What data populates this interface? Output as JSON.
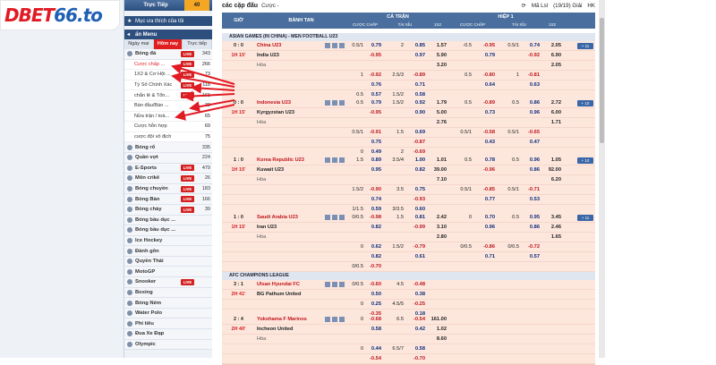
{
  "brand": {
    "logo_left": "D",
    "logo_mid": "BET",
    "logo_num": "66.to"
  },
  "sidebar": {
    "live_label": "Trực Tiếp",
    "live_count": "40",
    "fav_label": "Mục ưa thích của tôi",
    "menu_label": "ẩn Menu",
    "day_tabs": [
      "Ngày mai",
      "Hôm nay",
      "Trực tiếp"
    ],
    "sports": [
      {
        "name": "Bóng đá",
        "live": true,
        "count": "343"
      },
      {
        "name": "Bóng rổ",
        "live": false,
        "count": "335"
      },
      {
        "name": "Quần vợt",
        "live": false,
        "count": "224"
      },
      {
        "name": "E-Sports",
        "live": true,
        "count": "479"
      },
      {
        "name": "Môn crikê",
        "live": true,
        "count": "26"
      },
      {
        "name": "Bóng chuyền",
        "live": true,
        "count": "183"
      },
      {
        "name": "Bóng Bàn",
        "live": true,
        "count": "166"
      },
      {
        "name": "Bóng chày",
        "live": true,
        "count": "39"
      },
      {
        "name": "Bóng bầu dục ...",
        "live": false,
        "count": ""
      },
      {
        "name": "Bóng bầu dục ...",
        "live": false,
        "count": ""
      },
      {
        "name": "Ice Hockey",
        "live": false,
        "count": ""
      },
      {
        "name": "Đánh gôn",
        "live": false,
        "count": ""
      },
      {
        "name": "Quyền Thái",
        "live": false,
        "count": ""
      },
      {
        "name": "MotoGP",
        "live": false,
        "count": ""
      },
      {
        "name": "Snooker",
        "live": true,
        "count": ""
      },
      {
        "name": "Boxing",
        "live": false,
        "count": ""
      },
      {
        "name": "Bóng Ném",
        "live": false,
        "count": ""
      },
      {
        "name": "Water Polo",
        "live": false,
        "count": ""
      },
      {
        "name": "Phi tiêu",
        "live": false,
        "count": ""
      },
      {
        "name": "Đua Xe Đạp",
        "live": false,
        "count": ""
      },
      {
        "name": "Olympic",
        "live": false,
        "count": ""
      }
    ],
    "football_sub": [
      {
        "name": "Cược chấp ...",
        "live": true,
        "count": "266"
      },
      {
        "name": "1X2 & Cơ Hội ...",
        "live": true,
        "count": "73"
      },
      {
        "name": "Tỷ Số Chính Xác",
        "live": true,
        "count": "118"
      },
      {
        "name": "chẵn lẻ & Tổn...",
        "live": true,
        "count": "161"
      },
      {
        "name": "Bàn đầu/Bàn ...",
        "live": false,
        "count": "32"
      },
      {
        "name": "Nửa trận / toà...",
        "live": false,
        "count": "65"
      },
      {
        "name": "Cược hỗn hợp",
        "live": false,
        "count": "69"
      },
      {
        "name": "cược đội vô địch",
        "live": false,
        "count": "75"
      }
    ]
  },
  "topbar": {
    "title": "các cặp đấu",
    "market_select": "Cược -",
    "view_select": "Mã Lsl",
    "matches_count": "(19/19) Giải",
    "odds_type": "HK"
  },
  "table_header": {
    "time": "GIỜ",
    "teams": "BÀNH TAN",
    "full_time": "CẢ TRẬN",
    "first_half": "HIỆP 1",
    "hdp": "CƯỢC CHẤP",
    "ou": "TÀI XỈU",
    "x12": "1X2"
  },
  "leagues": [
    {
      "name": "ASIAN GAMES (IN CHINA) - MEN FOOTBALL U23"
    },
    {
      "name": "AFC CHAMPIONS LEAGUE"
    }
  ],
  "matches": [
    {
      "score": "0 : 0",
      "period": "1H 15'",
      "home": "China U23",
      "away": "India U23",
      "draw": "Hòa",
      "more": "+ 11",
      "rows": [
        [
          "0.5/1",
          "0.79",
          "2",
          "0.85",
          "1.57",
          "-0.5",
          "-0.95",
          "0.5/1",
          "0.74",
          "2.05"
        ],
        [
          "",
          "-0.95",
          "",
          "0.97",
          "5.90",
          "",
          "0.79",
          "",
          "-0.92",
          "6.90"
        ],
        [
          "",
          "",
          "",
          "",
          "3.20",
          "",
          "",
          "",
          "",
          "2.05"
        ]
      ],
      "extra": [
        [
          "1",
          "-0.92",
          "2.5/3",
          "-0.89",
          "",
          "0.5",
          "-0.80",
          "1",
          "-0.81",
          ""
        ],
        [
          "",
          "0.76",
          "",
          "0.71",
          "",
          "",
          "0.64",
          "",
          "0.63",
          ""
        ],
        [
          "0.5",
          "0.57",
          "1.5/2",
          "0.58",
          "",
          "",
          "",
          "",
          "",
          ""
        ],
        [
          "",
          "-0.73",
          "",
          "-0.76",
          "",
          "",
          "",
          "",
          "",
          ""
        ]
      ]
    },
    {
      "score": "0 : 0",
      "period": "1H 15'",
      "home": "Indonesia U23",
      "away": "Kyrgyzstan U23",
      "draw": "Hòa",
      "more": "+ 10",
      "rows": [
        [
          "0.5",
          "0.79",
          "1.5/2",
          "0.92",
          "1.79",
          "0.5",
          "-0.89",
          "0.5",
          "0.86",
          "2.72"
        ],
        [
          "",
          "-0.95",
          "",
          "0.90",
          "5.00",
          "",
          "0.73",
          "",
          "0.96",
          "6.00"
        ],
        [
          "",
          "",
          "",
          "",
          "2.76",
          "",
          "",
          "",
          "",
          "1.71"
        ]
      ],
      "extra": [
        [
          "0.5/1",
          "-0.91",
          "1.5",
          "0.69",
          "",
          "0.5/1",
          "-0.58",
          "0.5/1",
          "-0.65",
          ""
        ],
        [
          "",
          "0.75",
          "",
          "-0.87",
          "",
          "",
          "0.43",
          "",
          "0.47",
          ""
        ],
        [
          "0",
          "0.49",
          "2",
          "-0.69",
          "",
          "",
          "",
          "",
          "",
          ""
        ],
        [
          "",
          "-0.65",
          "",
          "0.51",
          "",
          "",
          "",
          "",
          "",
          ""
        ]
      ]
    },
    {
      "score": "1 : 0",
      "period": "1H 15'",
      "home": "Korea Republic U23",
      "away": "Kuwait U23",
      "draw": "Hòa",
      "more": "+ 10",
      "rows": [
        [
          "1.5",
          "0.89",
          "3.5/4",
          "1.00",
          "1.01",
          "0.5",
          "0.78",
          "0.5",
          "0.96",
          "1.05"
        ],
        [
          "",
          "0.95",
          "",
          "0.82",
          "39.00",
          "",
          "-0.96",
          "",
          "0.86",
          "92.00"
        ],
        [
          "",
          "",
          "",
          "",
          "7.10",
          "",
          "",
          "",
          "",
          "6.20"
        ]
      ],
      "extra": [
        [
          "1.5/2",
          "-0.90",
          "3.5",
          "0.75",
          "",
          "0.5/1",
          "-0.85",
          "0.5/1",
          "-0.71",
          ""
        ],
        [
          "",
          "0.74",
          "",
          "-0.93",
          "",
          "",
          "0.77",
          "",
          "0.53",
          ""
        ],
        [
          "1/1.5",
          "0.59",
          "3/3.5",
          "0.60",
          "",
          "",
          "",
          "",
          "",
          ""
        ],
        [
          "",
          "-0.75",
          "",
          "-0.73",
          "",
          "",
          "",
          "",
          "",
          ""
        ]
      ]
    },
    {
      "score": "1 : 0",
      "period": "1H 15'",
      "home": "Saudi Arabia U23",
      "away": "Iran U23",
      "draw": "Hòa",
      "more": "+ 11",
      "rows": [
        [
          "0/0.5",
          "-0.98",
          "1.5",
          "0.81",
          "2.42",
          "0",
          "0.70",
          "0.5",
          "0.95",
          "3.45"
        ],
        [
          "",
          "0.82",
          "",
          "-0.99",
          "3.10",
          "",
          "0.96",
          "",
          "0.86",
          "2.46"
        ],
        [
          "",
          "",
          "",
          "",
          "2.80",
          "",
          "",
          "",
          "",
          "1.65"
        ]
      ],
      "extra": [
        [
          "0",
          "0.62",
          "1.5/2",
          "-0.79",
          "",
          "0/0.5",
          "-0.86",
          "0/0.5",
          "-0.72",
          ""
        ],
        [
          "",
          "0.82",
          "",
          "0.61",
          "",
          "",
          "0.71",
          "",
          "0.57",
          ""
        ],
        [
          "0/0.5",
          "-0.70",
          "",
          "",
          "",
          "",
          "",
          "",
          "",
          ""
        ],
        [
          "",
          "0.54",
          "",
          "-0.70",
          "",
          "",
          "",
          "",
          "",
          ""
        ]
      ]
    },
    {
      "score": "3 : 1",
      "period": "2H 41'",
      "home": "Ulsan Hyundai FC",
      "away": "BG Pathum United",
      "draw": "",
      "more": "",
      "rows": [
        [
          "0/0.5",
          "-0.60",
          "4.5",
          "-0.48",
          "",
          "",
          "",
          "",
          "",
          ""
        ],
        [
          "",
          "0.50",
          "",
          "0.38",
          "",
          "",
          "",
          "",
          "",
          ""
        ],
        [
          "0",
          "0.25",
          "4.5/5",
          "-0.25",
          "",
          "",
          "",
          "",
          "",
          ""
        ],
        [
          "",
          "-0.35",
          "",
          "0.18",
          "",
          "",
          "",
          "",
          "",
          ""
        ]
      ],
      "extra": []
    },
    {
      "score": "2 : 4",
      "period": "2H 40'",
      "home": "Yokohama F Marinos",
      "away": "Incheon United",
      "draw": "Hòa",
      "more": "",
      "rows": [
        [
          "0",
          "-0.68",
          "6.5",
          "-0.54",
          "161.00",
          "",
          "",
          "",
          "",
          ""
        ],
        [
          "",
          "0.58",
          "",
          "0.42",
          "1.02",
          "",
          "",
          "",
          "",
          ""
        ],
        [
          "",
          "",
          "",
          "",
          "8.60",
          "",
          "",
          "",
          "",
          ""
        ],
        [
          "0",
          "0.44",
          "6.5/7",
          "0.58",
          "",
          "",
          "",
          "",
          "",
          ""
        ],
        [
          "",
          "-0.54",
          "",
          "-0.70",
          "",
          "",
          "",
          "",
          "",
          ""
        ]
      ],
      "extra": []
    }
  ]
}
